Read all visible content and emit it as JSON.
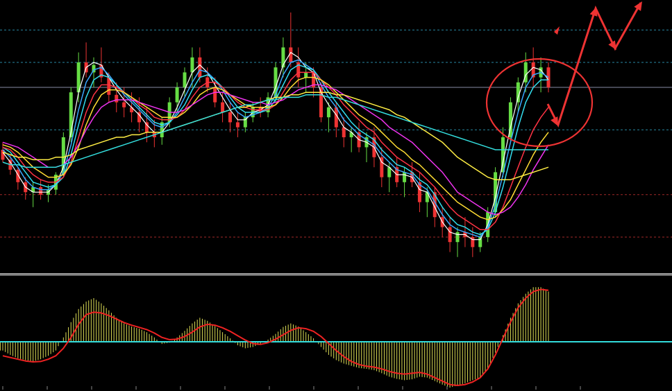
{
  "chart_data": [
    {
      "type": "candlestick",
      "panel": "price",
      "title": "",
      "xlabel": "",
      "ylabel": "",
      "ylim": [
        0,
        100
      ],
      "grid": true,
      "x_ticks": [
        "",
        "",
        "",
        "",
        "",
        "",
        "",
        "",
        "",
        "",
        "",
        "",
        "",
        ""
      ],
      "horizontal_levels": [
        {
          "value": 93,
          "color": "#33aacc",
          "style": "dashed"
        },
        {
          "value": 80,
          "color": "#33aacc",
          "style": "dashed"
        },
        {
          "value": 70,
          "color": "#aab0d0",
          "style": "solid"
        },
        {
          "value": 53,
          "color": "#33aacc",
          "style": "dashed"
        },
        {
          "value": 27,
          "color": "#cc3333",
          "style": "dashed"
        },
        {
          "value": 10,
          "color": "#cc3333",
          "style": "dashed"
        }
      ],
      "candles": [
        [
          45,
          48,
          40,
          41
        ],
        [
          41,
          43,
          35,
          37
        ],
        [
          37,
          38,
          29,
          32
        ],
        [
          32,
          34,
          25,
          28
        ],
        [
          28,
          32,
          22,
          30
        ],
        [
          30,
          33,
          25,
          27
        ],
        [
          27,
          31,
          24,
          29
        ],
        [
          29,
          36,
          27,
          35
        ],
        [
          35,
          52,
          34,
          50
        ],
        [
          50,
          70,
          48,
          68
        ],
        [
          68,
          84,
          64,
          80
        ],
        [
          80,
          88,
          74,
          76
        ],
        [
          76,
          82,
          70,
          79
        ],
        [
          79,
          86,
          72,
          74
        ],
        [
          74,
          76,
          64,
          67
        ],
        [
          67,
          72,
          60,
          64
        ],
        [
          64,
          70,
          58,
          62
        ],
        [
          62,
          68,
          56,
          60
        ],
        [
          60,
          66,
          52,
          56
        ],
        [
          56,
          62,
          48,
          52
        ],
        [
          52,
          57,
          46,
          50
        ],
        [
          50,
          58,
          47,
          56
        ],
        [
          56,
          66,
          54,
          64
        ],
        [
          64,
          72,
          60,
          70
        ],
        [
          70,
          78,
          66,
          76
        ],
        [
          76,
          86,
          70,
          82
        ],
        [
          82,
          86,
          72,
          74
        ],
        [
          74,
          78,
          68,
          70
        ],
        [
          70,
          74,
          62,
          64
        ],
        [
          64,
          68,
          56,
          60
        ],
        [
          60,
          64,
          52,
          56
        ],
        [
          56,
          60,
          50,
          54
        ],
        [
          54,
          60,
          52,
          58
        ],
        [
          58,
          64,
          56,
          62
        ],
        [
          62,
          66,
          58,
          60
        ],
        [
          60,
          68,
          58,
          66
        ],
        [
          66,
          80,
          64,
          78
        ],
        [
          78,
          90,
          74,
          86
        ],
        [
          86,
          100,
          78,
          80
        ],
        [
          80,
          86,
          70,
          74
        ],
        [
          74,
          80,
          68,
          76
        ],
        [
          76,
          78,
          66,
          70
        ],
        [
          70,
          72,
          56,
          58
        ],
        [
          58,
          64,
          52,
          62
        ],
        [
          62,
          64,
          50,
          54
        ],
        [
          54,
          58,
          46,
          50
        ],
        [
          50,
          54,
          44,
          52
        ],
        [
          52,
          56,
          44,
          46
        ],
        [
          46,
          52,
          40,
          50
        ],
        [
          50,
          54,
          38,
          42
        ],
        [
          42,
          46,
          30,
          34
        ],
        [
          34,
          40,
          28,
          38
        ],
        [
          38,
          42,
          30,
          32
        ],
        [
          32,
          38,
          26,
          36
        ],
        [
          36,
          40,
          30,
          32
        ],
        [
          32,
          36,
          20,
          24
        ],
        [
          24,
          30,
          18,
          28
        ],
        [
          28,
          30,
          14,
          18
        ],
        [
          18,
          22,
          10,
          14
        ],
        [
          14,
          18,
          4,
          8
        ],
        [
          8,
          14,
          2,
          12
        ],
        [
          12,
          18,
          6,
          10
        ],
        [
          10,
          14,
          2,
          6
        ],
        [
          6,
          12,
          4,
          10
        ],
        [
          10,
          22,
          8,
          20
        ],
        [
          20,
          38,
          18,
          36
        ],
        [
          36,
          54,
          34,
          50
        ],
        [
          50,
          66,
          48,
          64
        ],
        [
          64,
          74,
          60,
          72
        ],
        [
          72,
          84,
          68,
          80
        ],
        [
          80,
          86,
          70,
          74
        ],
        [
          74,
          82,
          68,
          78
        ],
        [
          78,
          80,
          68,
          70
        ]
      ],
      "series": [
        {
          "name": "",
          "color": "#ffffff",
          "width": 1.2,
          "values": [
            44,
            40,
            35,
            30,
            28,
            28,
            28,
            31,
            38,
            52,
            68,
            78,
            80,
            79,
            74,
            69,
            65,
            62,
            59,
            55,
            52,
            52,
            56,
            62,
            69,
            76,
            79,
            76,
            71,
            66,
            61,
            57,
            57,
            60,
            61,
            63,
            70,
            79,
            84,
            82,
            78,
            76,
            68,
            63,
            59,
            54,
            52,
            49,
            48,
            46,
            40,
            38,
            35,
            35,
            34,
            29,
            28,
            22,
            16,
            12,
            11,
            11,
            9,
            9,
            15,
            26,
            40,
            54,
            66,
            75,
            78,
            77,
            73
          ]
        },
        {
          "name": "",
          "color": "#3aa8ff",
          "width": 1.5,
          "values": [
            45,
            42,
            38,
            33,
            30,
            29,
            29,
            31,
            36,
            47,
            61,
            72,
            77,
            78,
            75,
            71,
            67,
            64,
            61,
            58,
            55,
            54,
            56,
            60,
            66,
            72,
            77,
            76,
            73,
            69,
            64,
            60,
            58,
            59,
            60,
            62,
            67,
            75,
            80,
            81,
            79,
            77,
            71,
            66,
            62,
            57,
            54,
            51,
            49,
            47,
            43,
            40,
            37,
            36,
            35,
            31,
            29,
            24,
            19,
            15,
            13,
            12,
            11,
            10,
            14,
            23,
            35,
            48,
            60,
            70,
            75,
            76,
            74
          ]
        },
        {
          "name": "",
          "color": "#33ddee",
          "width": 1.5,
          "values": [
            46,
            44,
            40,
            36,
            32,
            31,
            30,
            31,
            34,
            43,
            55,
            66,
            73,
            75,
            74,
            71,
            68,
            65,
            62,
            59,
            56,
            55,
            56,
            59,
            63,
            69,
            74,
            75,
            73,
            70,
            66,
            62,
            60,
            60,
            60,
            61,
            65,
            71,
            77,
            79,
            78,
            77,
            73,
            68,
            64,
            60,
            56,
            53,
            51,
            49,
            45,
            42,
            39,
            38,
            36,
            33,
            31,
            27,
            22,
            18,
            15,
            14,
            12,
            11,
            13,
            20,
            30,
            42,
            54,
            64,
            70,
            73,
            73
          ]
        },
        {
          "name": "",
          "color": "#ff3344",
          "width": 1.5,
          "values": [
            46,
            45,
            42,
            38,
            35,
            33,
            32,
            32,
            34,
            40,
            50,
            60,
            67,
            71,
            71,
            70,
            68,
            66,
            63,
            61,
            58,
            57,
            57,
            58,
            61,
            66,
            70,
            72,
            72,
            70,
            67,
            64,
            62,
            61,
            61,
            61,
            63,
            68,
            73,
            76,
            76,
            76,
            73,
            70,
            67,
            63,
            60,
            57,
            54,
            52,
            48,
            45,
            42,
            40,
            38,
            36,
            33,
            30,
            26,
            22,
            19,
            17,
            15,
            13,
            13,
            16,
            22,
            30,
            38,
            46,
            53,
            58,
            62
          ]
        },
        {
          "name": "",
          "color": "#ffdd33",
          "width": 1.5,
          "values": [
            47,
            46,
            44,
            41,
            38,
            36,
            34,
            34,
            35,
            39,
            46,
            55,
            62,
            67,
            69,
            69,
            68,
            66,
            64,
            62,
            60,
            58,
            58,
            58,
            60,
            63,
            67,
            69,
            70,
            69,
            67,
            65,
            63,
            62,
            62,
            62,
            63,
            66,
            70,
            73,
            74,
            74,
            73,
            71,
            68,
            65,
            62,
            59,
            57,
            55,
            52,
            49,
            46,
            44,
            41,
            39,
            36,
            33,
            30,
            27,
            24,
            22,
            20,
            18,
            17,
            18,
            21,
            25,
            31,
            37,
            43,
            48,
            52
          ]
        },
        {
          "name": "",
          "color": "#ee33ee",
          "width": 1.5,
          "values": [
            48,
            47,
            46,
            44,
            42,
            40,
            38,
            38,
            39,
            42,
            47,
            53,
            58,
            62,
            64,
            65,
            65,
            65,
            64,
            63,
            62,
            61,
            60,
            60,
            61,
            63,
            65,
            67,
            68,
            68,
            67,
            66,
            65,
            64,
            64,
            63,
            64,
            65,
            67,
            69,
            70,
            71,
            71,
            70,
            69,
            67,
            65,
            63,
            61,
            59,
            57,
            54,
            52,
            50,
            48,
            45,
            42,
            39,
            36,
            32,
            28,
            26,
            24,
            22,
            20,
            19,
            20,
            22,
            26,
            31,
            37,
            42,
            47
          ]
        },
        {
          "name": "",
          "color": "#ffee44",
          "width": 1.5,
          "values": [
            44,
            43,
            42,
            42,
            41,
            41,
            41,
            42,
            42,
            43,
            45,
            46,
            47,
            48,
            49,
            50,
            50,
            51,
            51,
            52,
            52,
            52,
            53,
            54,
            55,
            56,
            57,
            58,
            59,
            60,
            61,
            62,
            62,
            63,
            64,
            65,
            66,
            66,
            67,
            67,
            68,
            68,
            68,
            68,
            67,
            67,
            66,
            65,
            64,
            63,
            62,
            61,
            59,
            58,
            56,
            54,
            52,
            50,
            48,
            45,
            42,
            40,
            38,
            36,
            34,
            33,
            33,
            33,
            34,
            35,
            36,
            37,
            38
          ]
        },
        {
          "name": "",
          "color": "#33dddd",
          "width": 1.5,
          "values": [
            40,
            39,
            39,
            38,
            38,
            38,
            38,
            38,
            39,
            40,
            41,
            42,
            43,
            44,
            45,
            46,
            47,
            48,
            49,
            50,
            51,
            52,
            53,
            54,
            55,
            56,
            57,
            58,
            59,
            60,
            61,
            62,
            63,
            63,
            64,
            65,
            65,
            66,
            66,
            66,
            67,
            67,
            67,
            66,
            66,
            65,
            64,
            63,
            62,
            61,
            60,
            59,
            58,
            57,
            56,
            55,
            54,
            53,
            52,
            51,
            50,
            49,
            48,
            47,
            46,
            45,
            45,
            45,
            45,
            45,
            45,
            45,
            45
          ]
        }
      ]
    },
    {
      "type": "bar",
      "panel": "oscillator",
      "title": "",
      "ylim": [
        -100,
        100
      ],
      "zero_line_color": "#33dddd",
      "bar_color": "#dddd55",
      "bars": [
        -20,
        -30,
        -38,
        -42,
        -45,
        -40,
        -32,
        -20,
        10,
        45,
        75,
        92,
        100,
        88,
        72,
        55,
        42,
        35,
        30,
        22,
        10,
        -5,
        -2,
        10,
        25,
        42,
        55,
        48,
        36,
        22,
        8,
        -8,
        -15,
        -12,
        -5,
        5,
        18,
        34,
        42,
        35,
        22,
        8,
        -12,
        -30,
        -42,
        -50,
        -55,
        -60,
        -62,
        -65,
        -72,
        -80,
        -85,
        -88,
        -86,
        -80,
        -82,
        -90,
        -98,
        -105,
        -100,
        -95,
        -88,
        -82,
        -60,
        -25,
        15,
        55,
        88,
        110,
        125,
        125,
        115
      ],
      "signal": {
        "color": "#ee2222",
        "values": [
          -32,
          -36,
          -40,
          -44,
          -46,
          -45,
          -40,
          -32,
          -15,
          10,
          40,
          62,
          68,
          66,
          60,
          52,
          44,
          38,
          33,
          28,
          20,
          10,
          5,
          6,
          12,
          22,
          34,
          40,
          38,
          32,
          24,
          14,
          4,
          -4,
          -6,
          -2,
          6,
          16,
          26,
          32,
          30,
          24,
          12,
          -4,
          -20,
          -34,
          -45,
          -52,
          -56,
          -58,
          -62,
          -68,
          -72,
          -74,
          -72,
          -70,
          -74,
          -82,
          -90,
          -98,
          -100,
          -98,
          -92,
          -82,
          -62,
          -30,
          8,
          45,
          78,
          100,
          115,
          120,
          118
        ]
      }
    }
  ],
  "annotations": {
    "circle_color": "#ee3333",
    "arrow_color": "#ee3333"
  }
}
